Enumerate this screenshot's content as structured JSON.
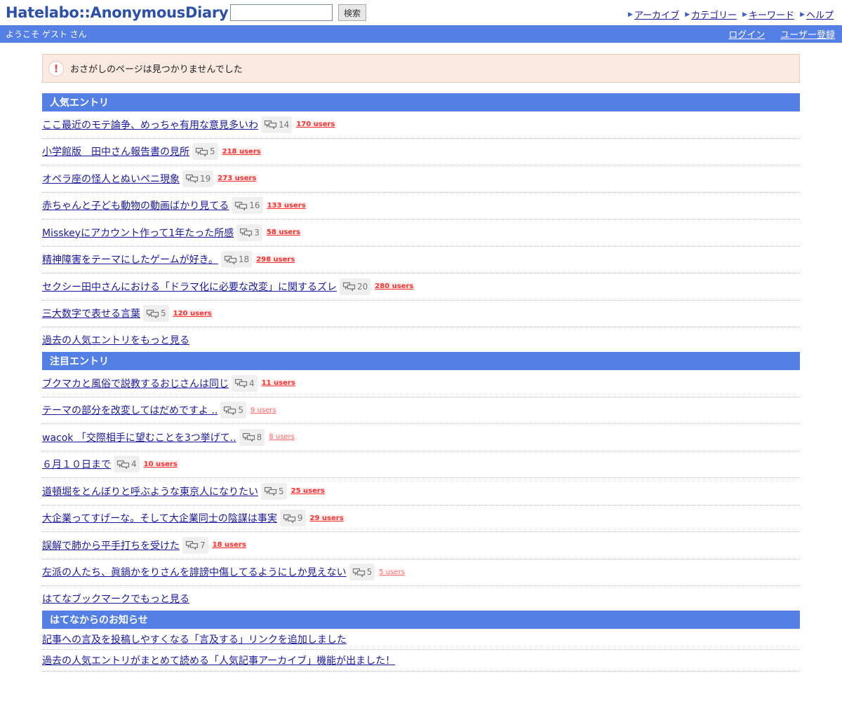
{
  "header": {
    "logo": "Hatelabo::AnonymousDiary",
    "search_placeholder": "",
    "search_button": "検索",
    "nav": [
      {
        "label": "アーカイブ"
      },
      {
        "label": "カテゴリー"
      },
      {
        "label": "キーワード"
      },
      {
        "label": "ヘルプ"
      }
    ]
  },
  "welcome_bar": {
    "greeting": "ようこそ ゲスト さん",
    "login": "ログイン",
    "register": "ユーザー登録"
  },
  "notice": {
    "icon": "!",
    "message": "おさがしのページは見つかりませんでした"
  },
  "popular": {
    "title": "人気エントリ",
    "entries": [
      {
        "title": "ここ最近のモテ論争、めっちゃ有用な意見多いわ",
        "comments": "14",
        "users": "170 users"
      },
      {
        "title": "小学館版　田中さん報告書の見所",
        "comments": "5",
        "users": "218 users"
      },
      {
        "title": "オペラ座の怪人とぬいペニ現象",
        "comments": "19",
        "users": "273 users"
      },
      {
        "title": "赤ちゃんと子ども動物の動画ばかり見てる",
        "comments": "16",
        "users": "133 users"
      },
      {
        "title": "Misskeyにアカウント作って1年たった所感",
        "comments": "3",
        "users": "58 users"
      },
      {
        "title": "精神障害をテーマにしたゲームが好き。",
        "comments": "18",
        "users": "298 users"
      },
      {
        "title": "セクシー田中さんにおける「ドラマ化に必要な改変」に関するズレ",
        "comments": "20",
        "users": "280 users"
      },
      {
        "title": "三大数字で表せる言葉",
        "comments": "5",
        "users": "120 users"
      }
    ],
    "more": "過去の人気エントリをもっと見る"
  },
  "featured": {
    "title": "注目エントリ",
    "entries": [
      {
        "title": "ブクマカと風俗で説教するおじさんは同じ",
        "comments": "4",
        "users": "11 users"
      },
      {
        "title": "テーマの部分を改変してはだめですよ ..",
        "comments": "5",
        "users": "9 users"
      },
      {
        "title": "wacok 「交際相手に望むことを3つ挙げて..",
        "comments": "8",
        "users": "8 users"
      },
      {
        "title": "６月１０日まで",
        "comments": "4",
        "users": "10 users"
      },
      {
        "title": "道頓堀をとんぼりと呼ぶような東京人になりたい",
        "comments": "5",
        "users": "25 users"
      },
      {
        "title": "大企業ってすげーな。そして大企業同士の陰謀は事実",
        "comments": "9",
        "users": "29 users"
      },
      {
        "title": "誤解で肺から平手打ちを受けた",
        "comments": "7",
        "users": "18 users"
      },
      {
        "title": "左派の人たち、眞鍋かをりさんを誹謗中傷してるようにしか見えない",
        "comments": "5",
        "users": "5 users"
      }
    ],
    "more": "はてなブックマークでもっと見る"
  },
  "news": {
    "title": "はてなからのお知らせ",
    "items": [
      {
        "title": "記事への言及を投稿しやすくなる「言及する」リンクを追加しました"
      },
      {
        "title": "過去の人気エントリがまとめて読める「人気記事アーカイブ」機能が出ました！"
      }
    ]
  },
  "colors": {
    "accent": "#5480e6",
    "logo": "#2c4fa8",
    "link": "#1a1a9c",
    "users_badge": "#ff3030",
    "notice_bg": "#fbe9e2"
  }
}
